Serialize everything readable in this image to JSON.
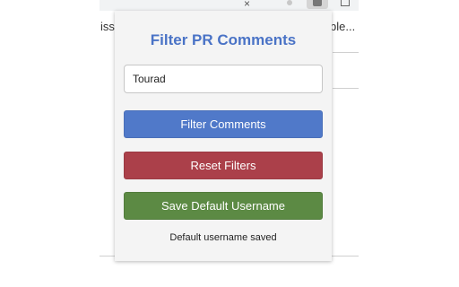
{
  "background": {
    "left_fragment": "iss",
    "right_fragment": "ble..."
  },
  "popup": {
    "title": "Filter PR Comments",
    "username_value": "Tourad",
    "filter_button": "Filter Comments",
    "reset_button": "Reset Filters",
    "save_button": "Save Default Username",
    "status": "Default username saved"
  },
  "colors": {
    "title": "#4a73c6",
    "filter_button": "#5079c9",
    "reset_button": "#ab404a",
    "save_button": "#5c8a44"
  },
  "icons": {
    "close": "close-icon",
    "extension": "extension-icon"
  }
}
